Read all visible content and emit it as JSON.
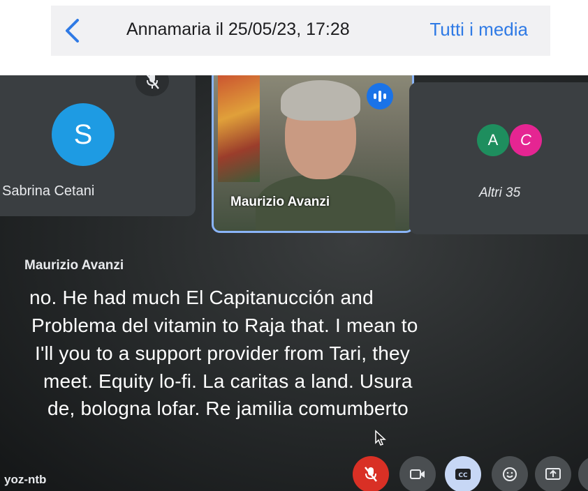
{
  "header": {
    "title": "Annamaria il 25/05/23, 17:28",
    "all_media": "Tutti i media",
    "accent_color": "#2f7ae5"
  },
  "meeting": {
    "tiles": {
      "sabrina": {
        "avatar_letter": "S",
        "name": "Sabrina Cetani",
        "avatar_color": "#1e9be3",
        "status_icon": "mic-off-icon"
      },
      "maurizio": {
        "name": "Maurizio Avanzi",
        "status_icon": "speaking-icon"
      },
      "others": {
        "avatar_a": "A",
        "avatar_c": "C",
        "label": "Altri 35"
      }
    },
    "captions": {
      "speaker": "Maurizio Avanzi",
      "lines": [
        "no. He had much El Capitanucción and",
        "Problema del vitamin to Raja that. I mean to",
        "I'll you to a support provider from Tari, they",
        "meet. Equity lo-fi. La caritas a land. Usura",
        "de, bologna lofar. Re jamilia comumberto"
      ]
    },
    "meeting_code": "yoz-ntb",
    "controls": [
      "mic-off-icon",
      "camera-icon",
      "captions-icon",
      "emoji-icon",
      "present-icon",
      "more-icon"
    ]
  }
}
